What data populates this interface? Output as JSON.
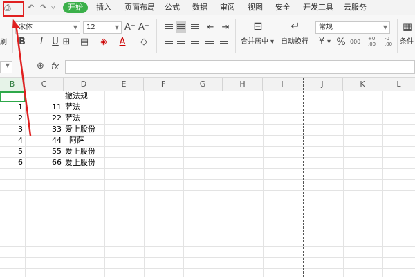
{
  "menubar": {
    "quick_access": [
      "↶",
      "↷",
      "▿"
    ],
    "tabs": [
      "开始",
      "插入",
      "页面布局",
      "公式",
      "数据",
      "审阅",
      "视图",
      "安全",
      "开发工具",
      "云服务"
    ],
    "active_tab": "开始"
  },
  "ribbon": {
    "left_fragment": "刷",
    "font_name": "宋体",
    "font_size": "12",
    "bold": "B",
    "font_grow": "A⁺",
    "font_shrink": "A⁻",
    "merge_center": "合并居中",
    "wrap_text": "自动换行",
    "number_format": "常规",
    "percent": "%",
    "thousands": "000",
    "dec_inc": "+0 .00",
    "dec_dec": "-0 .00",
    "conditional_fragment": "条件"
  },
  "formula_bar": {
    "fx_label": "fx",
    "value": ""
  },
  "columns": [
    "B",
    "C",
    "D",
    "E",
    "F",
    "G",
    "H",
    "I",
    "J",
    "K",
    "L"
  ],
  "rows": [
    {
      "b": "",
      "c": "",
      "d": "撤法规"
    },
    {
      "b": "1",
      "c": "11",
      "d": "萨法"
    },
    {
      "b": "2",
      "c": "22",
      "d": "萨法"
    },
    {
      "b": "3",
      "c": "33",
      "d": "爱上股份"
    },
    {
      "b": "4",
      "c": "44",
      "d": "阿萨"
    },
    {
      "b": "5",
      "c": "55",
      "d": "爱上股份"
    },
    {
      "b": "6",
      "c": "66",
      "d": "爱上股份"
    }
  ],
  "colors": {
    "active_tab": "#3bb04a",
    "annotation": "#e02020",
    "selection": "#2ea84a"
  }
}
